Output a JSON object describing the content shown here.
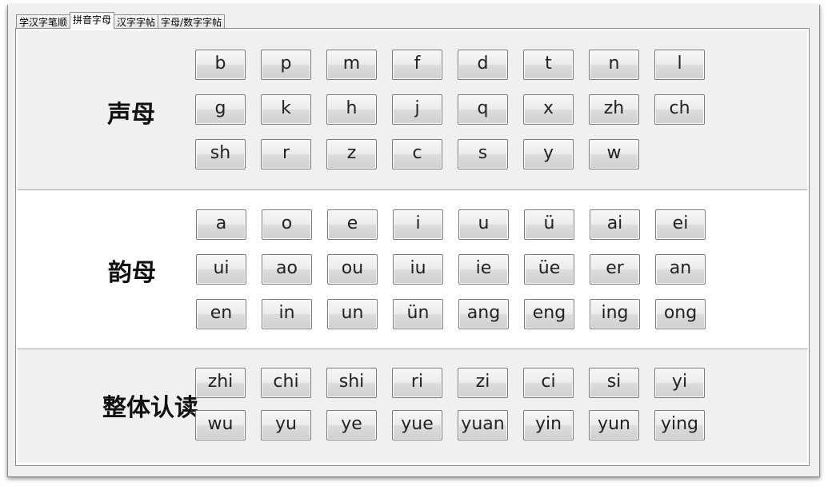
{
  "tabs": [
    "学汉字笔顺",
    "拼音字母",
    "汉字字帖",
    "字母/数字字帖"
  ],
  "active_tab": "拼音字母",
  "sections": [
    {
      "title": "声母",
      "rows": [
        [
          "b",
          "p",
          "m",
          "f",
          "d",
          "t",
          "n",
          "l"
        ],
        [
          "g",
          "k",
          "h",
          "j",
          "q",
          "x",
          "zh",
          "ch"
        ],
        [
          "sh",
          "r",
          "z",
          "c",
          "s",
          "y",
          "w"
        ]
      ]
    },
    {
      "title": "韵母",
      "rows": [
        [
          "a",
          "o",
          "e",
          "i",
          "u",
          "ü",
          "ai",
          "ei"
        ],
        [
          "ui",
          "ao",
          "ou",
          "iu",
          "ie",
          "üe",
          "er",
          "an"
        ],
        [
          "en",
          "in",
          "un",
          "ün",
          "ang",
          "eng",
          "ing",
          "ong"
        ]
      ]
    },
    {
      "title": "整体认读",
      "rows": [
        [
          "zhi",
          "chi",
          "shi",
          "ri",
          "zi",
          "ci",
          "si",
          "yi"
        ],
        [
          "wu",
          "yu",
          "ye",
          "yue",
          "yuan",
          "yin",
          "yun",
          "ying"
        ]
      ]
    }
  ]
}
